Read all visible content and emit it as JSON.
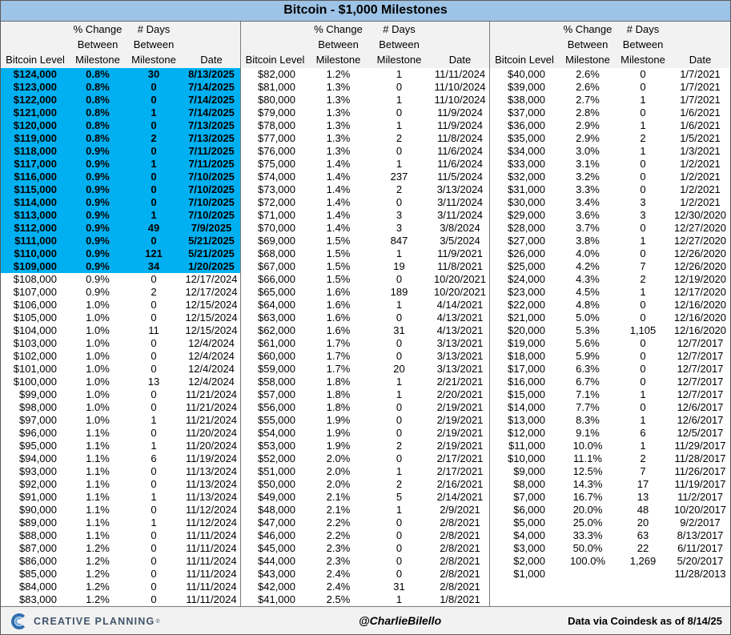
{
  "colors": {
    "title_bg": "#9dc3e6",
    "highlight": "#00b0f0",
    "header_bg": "#f2f2f2",
    "footer_bg": "#f2f2f2",
    "logo_blue": "#2f6fb0",
    "logo_light_blue": "#6fa8dc"
  },
  "chart_data": {
    "type": "table",
    "title": "Bitcoin - $1,000 Milestones",
    "headers": {
      "level": [
        "Bitcoin Level"
      ],
      "pct": [
        "% Change",
        "Between",
        "Milestone"
      ],
      "days": [
        "# Days",
        "Between",
        "Milestone"
      ],
      "date": [
        "Date"
      ]
    },
    "sections": [
      {
        "rows": [
          [
            "$124,000",
            "0.8%",
            "30",
            "8/13/2025",
            true
          ],
          [
            "$123,000",
            "0.8%",
            "0",
            "7/14/2025",
            true
          ],
          [
            "$122,000",
            "0.8%",
            "0",
            "7/14/2025",
            true
          ],
          [
            "$121,000",
            "0.8%",
            "1",
            "7/14/2025",
            true
          ],
          [
            "$120,000",
            "0.8%",
            "0",
            "7/13/2025",
            true
          ],
          [
            "$119,000",
            "0.8%",
            "2",
            "7/13/2025",
            true
          ],
          [
            "$118,000",
            "0.9%",
            "0",
            "7/11/2025",
            true
          ],
          [
            "$117,000",
            "0.9%",
            "1",
            "7/11/2025",
            true
          ],
          [
            "$116,000",
            "0.9%",
            "0",
            "7/10/2025",
            true
          ],
          [
            "$115,000",
            "0.9%",
            "0",
            "7/10/2025",
            true
          ],
          [
            "$114,000",
            "0.9%",
            "0",
            "7/10/2025",
            true
          ],
          [
            "$113,000",
            "0.9%",
            "1",
            "7/10/2025",
            true
          ],
          [
            "$112,000",
            "0.9%",
            "49",
            "7/9/2025",
            true
          ],
          [
            "$111,000",
            "0.9%",
            "0",
            "5/21/2025",
            true
          ],
          [
            "$110,000",
            "0.9%",
            "121",
            "5/21/2025",
            true
          ],
          [
            "$109,000",
            "0.9%",
            "34",
            "1/20/2025",
            true
          ],
          [
            "$108,000",
            "0.9%",
            "0",
            "12/17/2024"
          ],
          [
            "$107,000",
            "0.9%",
            "2",
            "12/17/2024"
          ],
          [
            "$106,000",
            "1.0%",
            "0",
            "12/15/2024"
          ],
          [
            "$105,000",
            "1.0%",
            "0",
            "12/15/2024"
          ],
          [
            "$104,000",
            "1.0%",
            "11",
            "12/15/2024"
          ],
          [
            "$103,000",
            "1.0%",
            "0",
            "12/4/2024"
          ],
          [
            "$102,000",
            "1.0%",
            "0",
            "12/4/2024"
          ],
          [
            "$101,000",
            "1.0%",
            "0",
            "12/4/2024"
          ],
          [
            "$100,000",
            "1.0%",
            "13",
            "12/4/2024"
          ],
          [
            "$99,000",
            "1.0%",
            "0",
            "11/21/2024"
          ],
          [
            "$98,000",
            "1.0%",
            "0",
            "11/21/2024"
          ],
          [
            "$97,000",
            "1.0%",
            "1",
            "11/21/2024"
          ],
          [
            "$96,000",
            "1.1%",
            "0",
            "11/20/2024"
          ],
          [
            "$95,000",
            "1.1%",
            "1",
            "11/20/2024"
          ],
          [
            "$94,000",
            "1.1%",
            "6",
            "11/19/2024"
          ],
          [
            "$93,000",
            "1.1%",
            "0",
            "11/13/2024"
          ],
          [
            "$92,000",
            "1.1%",
            "0",
            "11/13/2024"
          ],
          [
            "$91,000",
            "1.1%",
            "1",
            "11/13/2024"
          ],
          [
            "$90,000",
            "1.1%",
            "0",
            "11/12/2024"
          ],
          [
            "$89,000",
            "1.1%",
            "1",
            "11/12/2024"
          ],
          [
            "$88,000",
            "1.1%",
            "0",
            "11/11/2024"
          ],
          [
            "$87,000",
            "1.2%",
            "0",
            "11/11/2024"
          ],
          [
            "$86,000",
            "1.2%",
            "0",
            "11/11/2024"
          ],
          [
            "$85,000",
            "1.2%",
            "0",
            "11/11/2024"
          ],
          [
            "$84,000",
            "1.2%",
            "0",
            "11/11/2024"
          ],
          [
            "$83,000",
            "1.2%",
            "0",
            "11/11/2024"
          ]
        ]
      },
      {
        "rows": [
          [
            "$82,000",
            "1.2%",
            "1",
            "11/11/2024"
          ],
          [
            "$81,000",
            "1.3%",
            "0",
            "11/10/2024"
          ],
          [
            "$80,000",
            "1.3%",
            "1",
            "11/10/2024"
          ],
          [
            "$79,000",
            "1.3%",
            "0",
            "11/9/2024"
          ],
          [
            "$78,000",
            "1.3%",
            "1",
            "11/9/2024"
          ],
          [
            "$77,000",
            "1.3%",
            "2",
            "11/8/2024"
          ],
          [
            "$76,000",
            "1.3%",
            "0",
            "11/6/2024"
          ],
          [
            "$75,000",
            "1.4%",
            "1",
            "11/6/2024"
          ],
          [
            "$74,000",
            "1.4%",
            "237",
            "11/5/2024"
          ],
          [
            "$73,000",
            "1.4%",
            "2",
            "3/13/2024"
          ],
          [
            "$72,000",
            "1.4%",
            "0",
            "3/11/2024"
          ],
          [
            "$71,000",
            "1.4%",
            "3",
            "3/11/2024"
          ],
          [
            "$70,000",
            "1.4%",
            "3",
            "3/8/2024"
          ],
          [
            "$69,000",
            "1.5%",
            "847",
            "3/5/2024"
          ],
          [
            "$68,000",
            "1.5%",
            "1",
            "11/9/2021"
          ],
          [
            "$67,000",
            "1.5%",
            "19",
            "11/8/2021"
          ],
          [
            "$66,000",
            "1.5%",
            "0",
            "10/20/2021"
          ],
          [
            "$65,000",
            "1.6%",
            "189",
            "10/20/2021"
          ],
          [
            "$64,000",
            "1.6%",
            "1",
            "4/14/2021"
          ],
          [
            "$63,000",
            "1.6%",
            "0",
            "4/13/2021"
          ],
          [
            "$62,000",
            "1.6%",
            "31",
            "4/13/2021"
          ],
          [
            "$61,000",
            "1.7%",
            "0",
            "3/13/2021"
          ],
          [
            "$60,000",
            "1.7%",
            "0",
            "3/13/2021"
          ],
          [
            "$59,000",
            "1.7%",
            "20",
            "3/13/2021"
          ],
          [
            "$58,000",
            "1.8%",
            "1",
            "2/21/2021"
          ],
          [
            "$57,000",
            "1.8%",
            "1",
            "2/20/2021"
          ],
          [
            "$56,000",
            "1.8%",
            "0",
            "2/19/2021"
          ],
          [
            "$55,000",
            "1.9%",
            "0",
            "2/19/2021"
          ],
          [
            "$54,000",
            "1.9%",
            "0",
            "2/19/2021"
          ],
          [
            "$53,000",
            "1.9%",
            "2",
            "2/19/2021"
          ],
          [
            "$52,000",
            "2.0%",
            "0",
            "2/17/2021"
          ],
          [
            "$51,000",
            "2.0%",
            "1",
            "2/17/2021"
          ],
          [
            "$50,000",
            "2.0%",
            "2",
            "2/16/2021"
          ],
          [
            "$49,000",
            "2.1%",
            "5",
            "2/14/2021"
          ],
          [
            "$48,000",
            "2.1%",
            "1",
            "2/9/2021"
          ],
          [
            "$47,000",
            "2.2%",
            "0",
            "2/8/2021"
          ],
          [
            "$46,000",
            "2.2%",
            "0",
            "2/8/2021"
          ],
          [
            "$45,000",
            "2.3%",
            "0",
            "2/8/2021"
          ],
          [
            "$44,000",
            "2.3%",
            "0",
            "2/8/2021"
          ],
          [
            "$43,000",
            "2.4%",
            "0",
            "2/8/2021"
          ],
          [
            "$42,000",
            "2.4%",
            "31",
            "2/8/2021"
          ],
          [
            "$41,000",
            "2.5%",
            "1",
            "1/8/2021"
          ]
        ]
      },
      {
        "rows": [
          [
            "$40,000",
            "2.6%",
            "0",
            "1/7/2021"
          ],
          [
            "$39,000",
            "2.6%",
            "0",
            "1/7/2021"
          ],
          [
            "$38,000",
            "2.7%",
            "1",
            "1/7/2021"
          ],
          [
            "$37,000",
            "2.8%",
            "0",
            "1/6/2021"
          ],
          [
            "$36,000",
            "2.9%",
            "1",
            "1/6/2021"
          ],
          [
            "$35,000",
            "2.9%",
            "2",
            "1/5/2021"
          ],
          [
            "$34,000",
            "3.0%",
            "1",
            "1/3/2021"
          ],
          [
            "$33,000",
            "3.1%",
            "0",
            "1/2/2021"
          ],
          [
            "$32,000",
            "3.2%",
            "0",
            "1/2/2021"
          ],
          [
            "$31,000",
            "3.3%",
            "0",
            "1/2/2021"
          ],
          [
            "$30,000",
            "3.4%",
            "3",
            "1/2/2021"
          ],
          [
            "$29,000",
            "3.6%",
            "3",
            "12/30/2020"
          ],
          [
            "$28,000",
            "3.7%",
            "0",
            "12/27/2020"
          ],
          [
            "$27,000",
            "3.8%",
            "1",
            "12/27/2020"
          ],
          [
            "$26,000",
            "4.0%",
            "0",
            "12/26/2020"
          ],
          [
            "$25,000",
            "4.2%",
            "7",
            "12/26/2020"
          ],
          [
            "$24,000",
            "4.3%",
            "2",
            "12/19/2020"
          ],
          [
            "$23,000",
            "4.5%",
            "1",
            "12/17/2020"
          ],
          [
            "$22,000",
            "4.8%",
            "0",
            "12/16/2020"
          ],
          [
            "$21,000",
            "5.0%",
            "0",
            "12/16/2020"
          ],
          [
            "$20,000",
            "5.3%",
            "1,105",
            "12/16/2020"
          ],
          [
            "$19,000",
            "5.6%",
            "0",
            "12/7/2017"
          ],
          [
            "$18,000",
            "5.9%",
            "0",
            "12/7/2017"
          ],
          [
            "$17,000",
            "6.3%",
            "0",
            "12/7/2017"
          ],
          [
            "$16,000",
            "6.7%",
            "0",
            "12/7/2017"
          ],
          [
            "$15,000",
            "7.1%",
            "1",
            "12/7/2017"
          ],
          [
            "$14,000",
            "7.7%",
            "0",
            "12/6/2017"
          ],
          [
            "$13,000",
            "8.3%",
            "1",
            "12/6/2017"
          ],
          [
            "$12,000",
            "9.1%",
            "6",
            "12/5/2017"
          ],
          [
            "$11,000",
            "10.0%",
            "1",
            "11/29/2017"
          ],
          [
            "$10,000",
            "11.1%",
            "2",
            "11/28/2017"
          ],
          [
            "$9,000",
            "12.5%",
            "7",
            "11/26/2017"
          ],
          [
            "$8,000",
            "14.3%",
            "17",
            "11/19/2017"
          ],
          [
            "$7,000",
            "16.7%",
            "13",
            "11/2/2017"
          ],
          [
            "$6,000",
            "20.0%",
            "48",
            "10/20/2017"
          ],
          [
            "$5,000",
            "25.0%",
            "20",
            "9/2/2017"
          ],
          [
            "$4,000",
            "33.3%",
            "63",
            "8/13/2017"
          ],
          [
            "$3,000",
            "50.0%",
            "22",
            "6/11/2017"
          ],
          [
            "$2,000",
            "100.0%",
            "1,269",
            "5/20/2017"
          ],
          [
            "$1,000",
            "",
            "",
            "11/28/2013"
          ]
        ]
      }
    ]
  },
  "footer": {
    "logo_icon": "creative-planning-c-icon",
    "brand": "CREATIVE PLANNING",
    "brand_mark": "®",
    "handle": "@CharlieBilello",
    "source": "Data via Coindesk as of 8/14/25"
  }
}
